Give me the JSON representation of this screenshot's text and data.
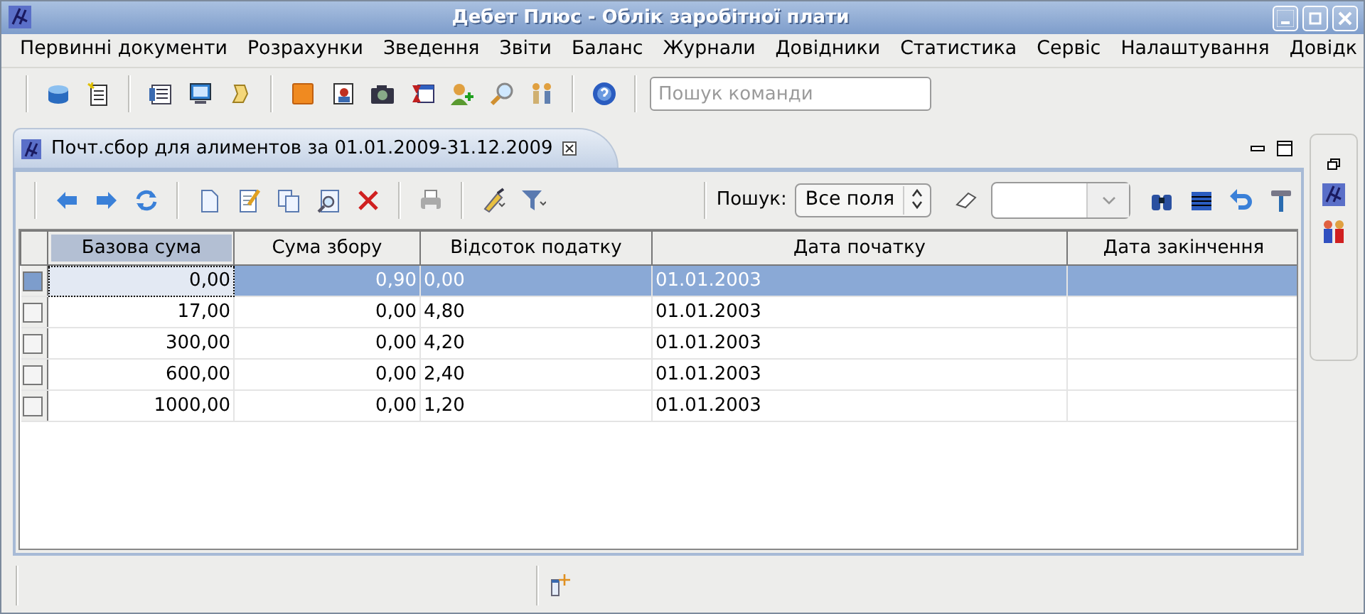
{
  "window": {
    "title": "Дебет Плюс - Облік заробітної плати"
  },
  "menu": [
    "Первинні документи",
    "Розрахунки",
    "Зведення",
    "Звіти",
    "Баланс",
    "Журнали",
    "Довідники",
    "Статистика",
    "Сервіс",
    "Налаштування",
    "Довідк"
  ],
  "command_search": {
    "placeholder": "Пошук команди"
  },
  "tab": {
    "label": "Почт.сбор для алиментов за 01.01.2009-31.12.2009",
    "selected": true
  },
  "search": {
    "label": "Пошук:",
    "field_mode": "Все поля"
  },
  "table": {
    "columns": [
      "Базова сума",
      "Сума збору",
      "Відсоток податку",
      "Дата початку",
      "Дата закінчення"
    ],
    "rows": [
      {
        "selected": true,
        "cells": [
          "0,00",
          "0,90",
          "0,00",
          "01.01.2003",
          ""
        ]
      },
      {
        "selected": false,
        "cells": [
          "17,00",
          "0,00",
          "4,80",
          "01.01.2003",
          ""
        ]
      },
      {
        "selected": false,
        "cells": [
          "300,00",
          "0,00",
          "4,20",
          "01.01.2003",
          ""
        ]
      },
      {
        "selected": false,
        "cells": [
          "600,00",
          "0,00",
          "2,40",
          "01.01.2003",
          ""
        ]
      },
      {
        "selected": false,
        "cells": [
          "1000,00",
          "0,00",
          "1,20",
          "01.01.2003",
          ""
        ]
      }
    ]
  }
}
